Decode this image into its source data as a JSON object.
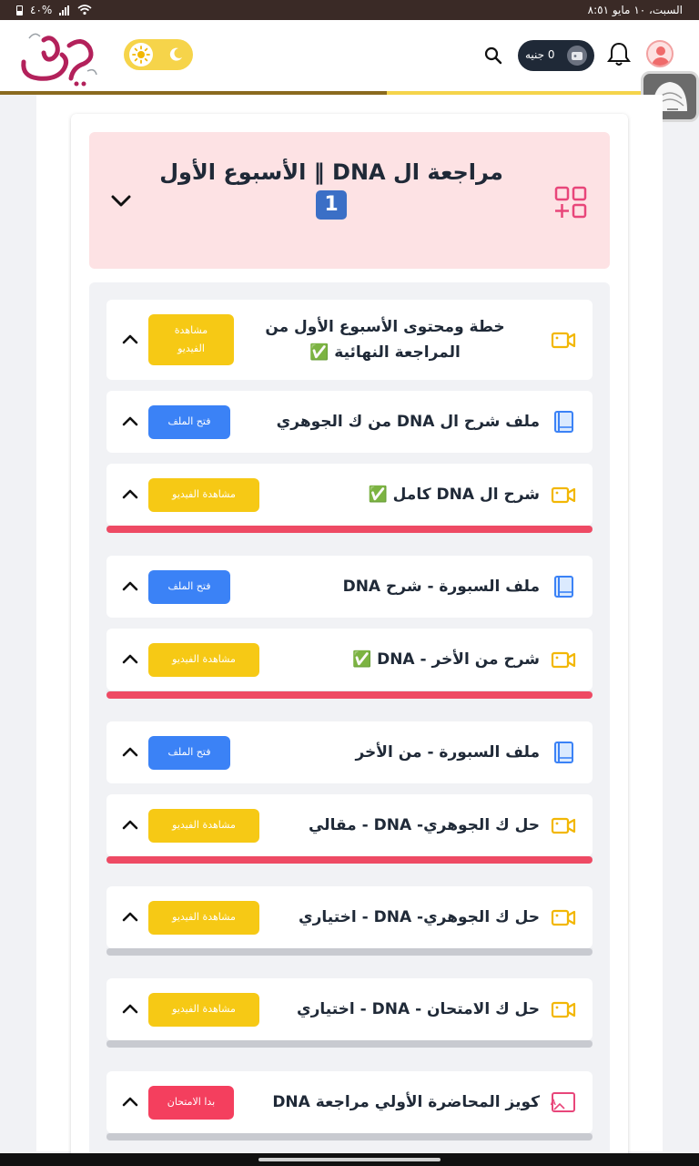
{
  "status_bar": {
    "datetime": "السبت، ١٠ مايو  ٨:٥١",
    "battery": "٤٠%"
  },
  "header": {
    "logo_text": "الجوهري",
    "wallet_label": "0 جنيه",
    "icons": [
      "avatar-icon",
      "bell-icon",
      "wallet-icon",
      "search-icon",
      "sun-icon",
      "moon-icon"
    ],
    "accent_color": "#f6d44a"
  },
  "section": {
    "title": "مراجعة ال DNA ‖ الأسبوع الأول",
    "keycap": "1",
    "header_bg": "#fde2e4"
  },
  "items": [
    {
      "title": "خطة ومحتوى الأسبوع الأول من المراجعة النهائية ✅",
      "icon": "video-icon",
      "button": "مشاهدة الفيديو",
      "button_color": "yellow",
      "progress": null
    },
    {
      "title": "ملف شرح ال DNA من ك الجوهري",
      "icon": "book-icon",
      "button": "فتح الملف",
      "button_color": "blue",
      "progress": null
    },
    {
      "title": "شرح ال DNA كامل ✅",
      "icon": "video-icon",
      "button": "مشاهدة الفيديو",
      "button_color": "yellow",
      "progress": 1.0
    },
    {
      "title": "ملف السبورة - شرح DNA",
      "icon": "book-icon",
      "button": "فتح الملف",
      "button_color": "blue",
      "progress": null
    },
    {
      "title": "شرح من الأخر - DNA ✅",
      "icon": "video-icon",
      "button": "مشاهدة الفيديو",
      "button_color": "yellow",
      "progress": 1.0
    },
    {
      "title": "ملف السبورة - من الأخر",
      "icon": "book-icon",
      "button": "فتح الملف",
      "button_color": "blue",
      "progress": null
    },
    {
      "title": "حل ك الجوهري- DNA - مقالي",
      "icon": "video-icon",
      "button": "مشاهدة الفيديو",
      "button_color": "yellow",
      "progress": 1.0
    },
    {
      "title": "حل ك الجوهري- DNA - اختياري",
      "icon": "video-icon",
      "button": "مشاهدة الفيديو",
      "button_color": "yellow",
      "progress": 0
    },
    {
      "title": "حل ك الامتحان - DNA - اختياري",
      "icon": "video-icon",
      "button": "مشاهدة الفيديو",
      "button_color": "yellow",
      "progress": 0
    },
    {
      "title": "كويز المحاضرة الأولي مراجعة DNA",
      "icon": "quiz-icon",
      "button": "بدا الامتحان",
      "button_color": "red",
      "progress": 0
    }
  ]
}
